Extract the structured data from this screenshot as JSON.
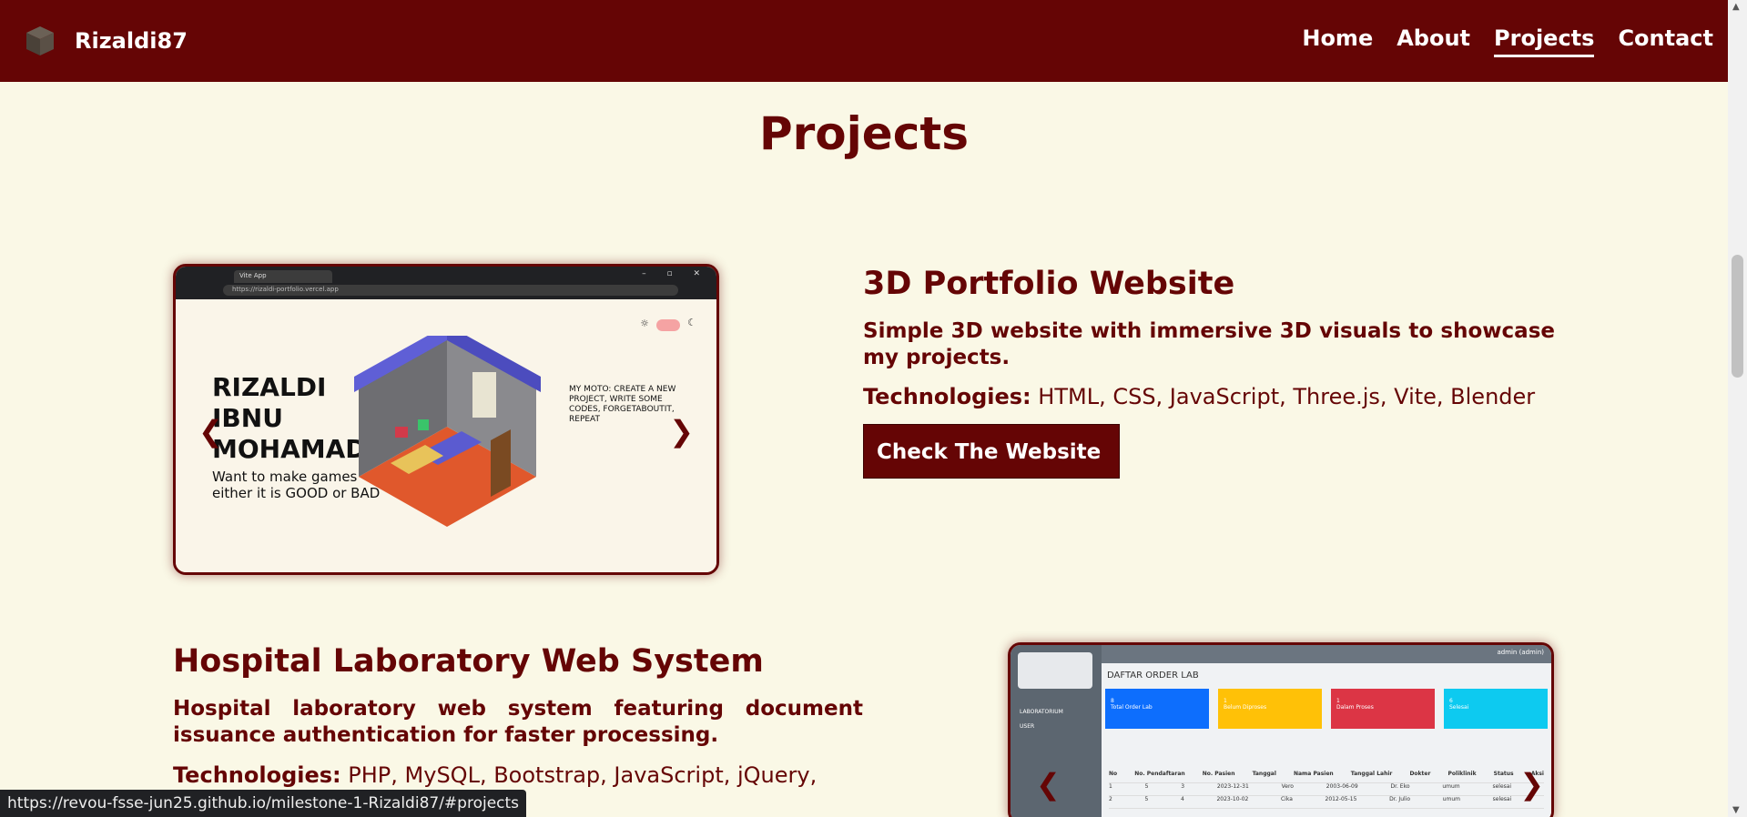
{
  "nav": {
    "brand": "Rizaldi87",
    "links": [
      "Home",
      "About",
      "Projects",
      "Contact"
    ],
    "active": "Projects"
  },
  "section": {
    "title": "Projects"
  },
  "projects": [
    {
      "title": "3D Portfolio Website",
      "description": "Simple 3D website with immersive 3D visuals to showcase my projects.",
      "tech_label": "Technologies:",
      "tech": "HTML, CSS, JavaScript, Three.js, Vite, Blender",
      "cta": "Check The Website",
      "shot": {
        "tab": "Vite App",
        "url": "https://rizaldi-portfolio.vercel.app",
        "hero_name": "RIZALDI IBNU MOHAMAD",
        "hero_tag": "Want to make games either it is GOOD or BAD",
        "moto": "MY MOTO: CREATE A NEW PROJECT, WRITE SOME CODES, FORGETABOUTIT, REPEAT"
      }
    },
    {
      "title": "Hospital Laboratory Web System",
      "description": "Hospital laboratory web system featuring document issuance authentication for faster processing.",
      "tech_label": "Technologies:",
      "tech": "PHP, MySQL, Bootstrap, JavaScript, jQuery,",
      "shot": {
        "user": "admin (admin)",
        "heading": "DAFTAR ORDER LAB",
        "menu": [
          "LABORATORIUM",
          "USER"
        ],
        "cards": [
          {
            "count": "8",
            "label": "Total Order Lab",
            "color": "#0d6efd"
          },
          {
            "count": "1",
            "label": "Belum Diproses",
            "color": "#ffc107"
          },
          {
            "count": "1",
            "label": "Dalam Proses",
            "color": "#dc3545"
          },
          {
            "count": "6",
            "label": "Selesai",
            "color": "#0dcaf0"
          }
        ],
        "columns": [
          "No",
          "No. Pendaftaran",
          "No. Pasien",
          "Tanggal",
          "Nama Pasien",
          "Tanggal Lahir",
          "Dokter",
          "Poliklinik",
          "Status",
          "Aksi"
        ],
        "rows": [
          [
            "1",
            "5",
            "3",
            "2023-12-31",
            "Vero",
            "2003-06-09",
            "Dr. Eko",
            "umum",
            "selesai",
            ""
          ],
          [
            "2",
            "5",
            "4",
            "2023-10-02",
            "Cika",
            "2012-05-15",
            "Dr. Julio",
            "umum",
            "selesai",
            ""
          ]
        ]
      }
    }
  ],
  "icons": {
    "brand": "cube-icon",
    "prev": "chevron-left-icon",
    "next": "chevron-right-icon",
    "sun": "sun-icon",
    "moon": "moon-icon"
  },
  "arrows": {
    "prev": "❮",
    "next": "❯"
  },
  "status_url": "https://revou-fsse-jun25.github.io/milestone-1-Rizaldi87/#projects"
}
